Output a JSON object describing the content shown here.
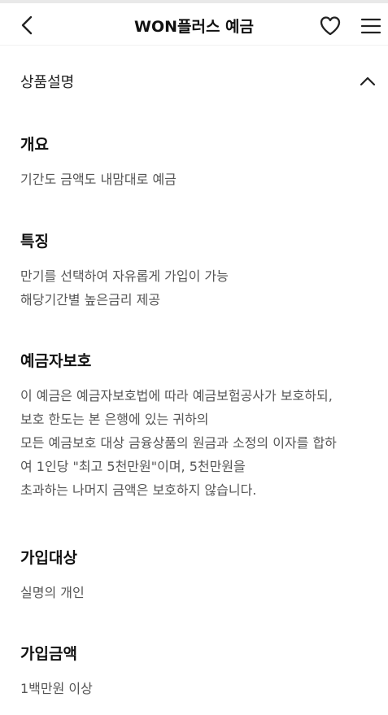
{
  "header": {
    "title": "WON플러스 예금",
    "icons": [
      "back-chevron-icon",
      "heart-icon",
      "hamburger-menu-icon"
    ]
  },
  "section": {
    "label": "상품설명",
    "toggle_icon": "chevron-up-icon"
  },
  "blocks": [
    {
      "heading": "개요",
      "lines": [
        "기간도 금액도 내맘대로 예금"
      ]
    },
    {
      "heading": "특징",
      "lines": [
        "만기를 선택하여 자유롭게 가입이 가능",
        "해당기간별 높은금리 제공"
      ]
    },
    {
      "heading": "예금자보호",
      "lines": [
        "이 예금은 예금자보호법에 따라 예금보험공사가 보호하되,",
        "보호 한도는 본 은행에 있는 귀하의",
        "모든 예금보호 대상 금융상품의 원금과 소정의 이자를 합하",
        "여 1인당 \"최고 5천만원\"이며, 5천만원을",
        "초과하는 나머지 금액은 보호하지 않습니다."
      ]
    },
    {
      "heading": "가입대상",
      "lines": [
        "실명의 개인"
      ]
    },
    {
      "heading": "가입금액",
      "lines": [
        "1백만원 이상"
      ]
    }
  ],
  "colors": {
    "text_primary": "#111111",
    "text_secondary": "#555555",
    "background": "#ffffff"
  }
}
